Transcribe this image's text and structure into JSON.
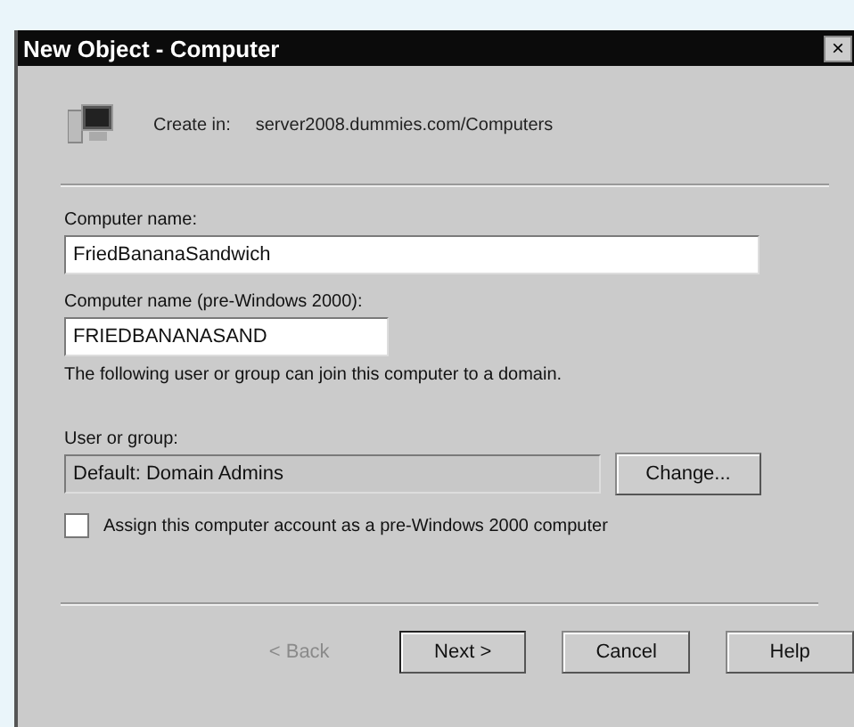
{
  "window": {
    "title": "New Object - Computer",
    "close": "×"
  },
  "create_in": {
    "label": "Create in:",
    "path": "server2008.dummies.com/Computers"
  },
  "computer_name": {
    "label": "Computer name:",
    "value": "FriedBananaSandwich"
  },
  "computer_name_pre2000": {
    "label": "Computer name (pre-Windows 2000):",
    "value": "FRIEDBANANASAND"
  },
  "join_note": "The following user or group can join this computer to a domain.",
  "user_or_group": {
    "label": "User or group:",
    "value": "Default: Domain Admins",
    "button": "Change..."
  },
  "assign_pre2000": {
    "label": "Assign this computer account as a pre-Windows 2000 computer",
    "checked": false
  },
  "buttons": [
    {
      "label": "< Back",
      "disabled": true,
      "default": false
    },
    {
      "label": "Next >",
      "disabled": false,
      "default": true
    },
    {
      "label": "Cancel",
      "disabled": false,
      "default": false
    },
    {
      "label": "Help",
      "disabled": false,
      "default": false
    }
  ]
}
